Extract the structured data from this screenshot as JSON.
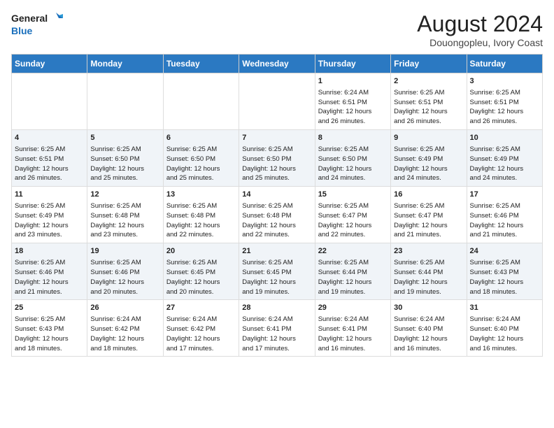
{
  "header": {
    "logo_line1": "General",
    "logo_line2": "Blue",
    "main_title": "August 2024",
    "subtitle": "Douongopleu, Ivory Coast"
  },
  "days_of_week": [
    "Sunday",
    "Monday",
    "Tuesday",
    "Wednesday",
    "Thursday",
    "Friday",
    "Saturday"
  ],
  "weeks": [
    [
      {
        "day": "",
        "text": ""
      },
      {
        "day": "",
        "text": ""
      },
      {
        "day": "",
        "text": ""
      },
      {
        "day": "",
        "text": ""
      },
      {
        "day": "1",
        "text": "Sunrise: 6:24 AM\nSunset: 6:51 PM\nDaylight: 12 hours\nand 26 minutes."
      },
      {
        "day": "2",
        "text": "Sunrise: 6:25 AM\nSunset: 6:51 PM\nDaylight: 12 hours\nand 26 minutes."
      },
      {
        "day": "3",
        "text": "Sunrise: 6:25 AM\nSunset: 6:51 PM\nDaylight: 12 hours\nand 26 minutes."
      }
    ],
    [
      {
        "day": "4",
        "text": "Sunrise: 6:25 AM\nSunset: 6:51 PM\nDaylight: 12 hours\nand 26 minutes."
      },
      {
        "day": "5",
        "text": "Sunrise: 6:25 AM\nSunset: 6:50 PM\nDaylight: 12 hours\nand 25 minutes."
      },
      {
        "day": "6",
        "text": "Sunrise: 6:25 AM\nSunset: 6:50 PM\nDaylight: 12 hours\nand 25 minutes."
      },
      {
        "day": "7",
        "text": "Sunrise: 6:25 AM\nSunset: 6:50 PM\nDaylight: 12 hours\nand 25 minutes."
      },
      {
        "day": "8",
        "text": "Sunrise: 6:25 AM\nSunset: 6:50 PM\nDaylight: 12 hours\nand 24 minutes."
      },
      {
        "day": "9",
        "text": "Sunrise: 6:25 AM\nSunset: 6:49 PM\nDaylight: 12 hours\nand 24 minutes."
      },
      {
        "day": "10",
        "text": "Sunrise: 6:25 AM\nSunset: 6:49 PM\nDaylight: 12 hours\nand 24 minutes."
      }
    ],
    [
      {
        "day": "11",
        "text": "Sunrise: 6:25 AM\nSunset: 6:49 PM\nDaylight: 12 hours\nand 23 minutes."
      },
      {
        "day": "12",
        "text": "Sunrise: 6:25 AM\nSunset: 6:48 PM\nDaylight: 12 hours\nand 23 minutes."
      },
      {
        "day": "13",
        "text": "Sunrise: 6:25 AM\nSunset: 6:48 PM\nDaylight: 12 hours\nand 22 minutes."
      },
      {
        "day": "14",
        "text": "Sunrise: 6:25 AM\nSunset: 6:48 PM\nDaylight: 12 hours\nand 22 minutes."
      },
      {
        "day": "15",
        "text": "Sunrise: 6:25 AM\nSunset: 6:47 PM\nDaylight: 12 hours\nand 22 minutes."
      },
      {
        "day": "16",
        "text": "Sunrise: 6:25 AM\nSunset: 6:47 PM\nDaylight: 12 hours\nand 21 minutes."
      },
      {
        "day": "17",
        "text": "Sunrise: 6:25 AM\nSunset: 6:46 PM\nDaylight: 12 hours\nand 21 minutes."
      }
    ],
    [
      {
        "day": "18",
        "text": "Sunrise: 6:25 AM\nSunset: 6:46 PM\nDaylight: 12 hours\nand 21 minutes."
      },
      {
        "day": "19",
        "text": "Sunrise: 6:25 AM\nSunset: 6:46 PM\nDaylight: 12 hours\nand 20 minutes."
      },
      {
        "day": "20",
        "text": "Sunrise: 6:25 AM\nSunset: 6:45 PM\nDaylight: 12 hours\nand 20 minutes."
      },
      {
        "day": "21",
        "text": "Sunrise: 6:25 AM\nSunset: 6:45 PM\nDaylight: 12 hours\nand 19 minutes."
      },
      {
        "day": "22",
        "text": "Sunrise: 6:25 AM\nSunset: 6:44 PM\nDaylight: 12 hours\nand 19 minutes."
      },
      {
        "day": "23",
        "text": "Sunrise: 6:25 AM\nSunset: 6:44 PM\nDaylight: 12 hours\nand 19 minutes."
      },
      {
        "day": "24",
        "text": "Sunrise: 6:25 AM\nSunset: 6:43 PM\nDaylight: 12 hours\nand 18 minutes."
      }
    ],
    [
      {
        "day": "25",
        "text": "Sunrise: 6:25 AM\nSunset: 6:43 PM\nDaylight: 12 hours\nand 18 minutes."
      },
      {
        "day": "26",
        "text": "Sunrise: 6:24 AM\nSunset: 6:42 PM\nDaylight: 12 hours\nand 18 minutes."
      },
      {
        "day": "27",
        "text": "Sunrise: 6:24 AM\nSunset: 6:42 PM\nDaylight: 12 hours\nand 17 minutes."
      },
      {
        "day": "28",
        "text": "Sunrise: 6:24 AM\nSunset: 6:41 PM\nDaylight: 12 hours\nand 17 minutes."
      },
      {
        "day": "29",
        "text": "Sunrise: 6:24 AM\nSunset: 6:41 PM\nDaylight: 12 hours\nand 16 minutes."
      },
      {
        "day": "30",
        "text": "Sunrise: 6:24 AM\nSunset: 6:40 PM\nDaylight: 12 hours\nand 16 minutes."
      },
      {
        "day": "31",
        "text": "Sunrise: 6:24 AM\nSunset: 6:40 PM\nDaylight: 12 hours\nand 16 minutes."
      }
    ]
  ]
}
